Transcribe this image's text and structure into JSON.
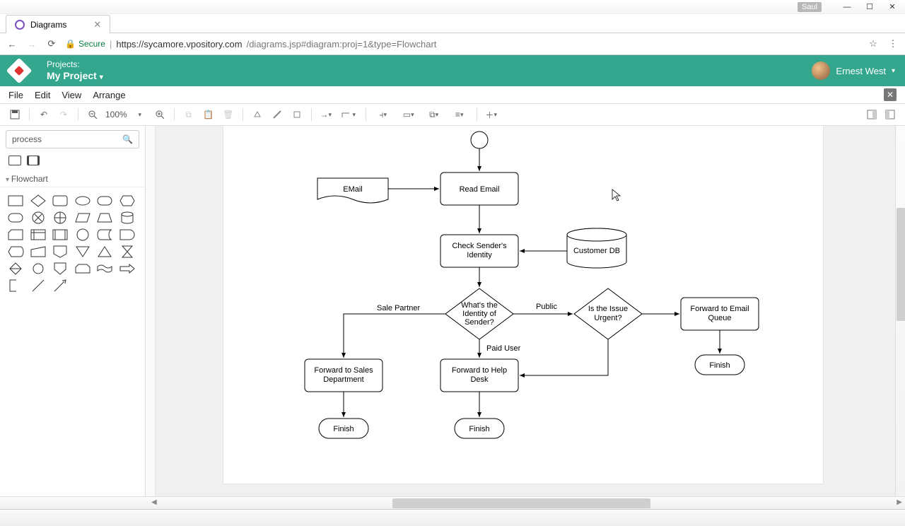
{
  "window": {
    "user_badge": "Saul"
  },
  "browser": {
    "tab_title": "Diagrams",
    "url_secure": "Secure",
    "url_host": "https://sycamore.vpository.com",
    "url_path": "/diagrams.jsp#diagram:proj=1&type=Flowchart"
  },
  "app_header": {
    "projects_label": "Projects:",
    "project_name": "My Project",
    "user_name": "Ernest West"
  },
  "menu": {
    "file": "File",
    "edit": "Edit",
    "view": "View",
    "arrange": "Arrange"
  },
  "toolbar": {
    "zoom": "100%"
  },
  "palette": {
    "search_value": "process",
    "section": "Flowchart"
  },
  "diagram": {
    "nodes": {
      "email": "EMail",
      "read_email": "Read Email",
      "check_sender_l1": "Check Sender's",
      "check_sender_l2": "Identity",
      "customer_db": "Customer DB",
      "decision_identity_l1": "What's the",
      "decision_identity_l2": "Identity of",
      "decision_identity_l3": "Sender?",
      "decision_urgent_l1": "Is the Issue",
      "decision_urgent_l2": "Urgent?",
      "fwd_email_l1": "Forward to Email",
      "fwd_email_l2": "Queue",
      "fwd_sales_l1": "Forward to Sales",
      "fwd_sales_l2": "Department",
      "fwd_help_l1": "Forward to Help",
      "fwd_help_l2": "Desk",
      "finish": "Finish"
    },
    "edge_labels": {
      "sale_partner": "Sale Partner",
      "public": "Public",
      "paid_user": "Paid User"
    }
  }
}
